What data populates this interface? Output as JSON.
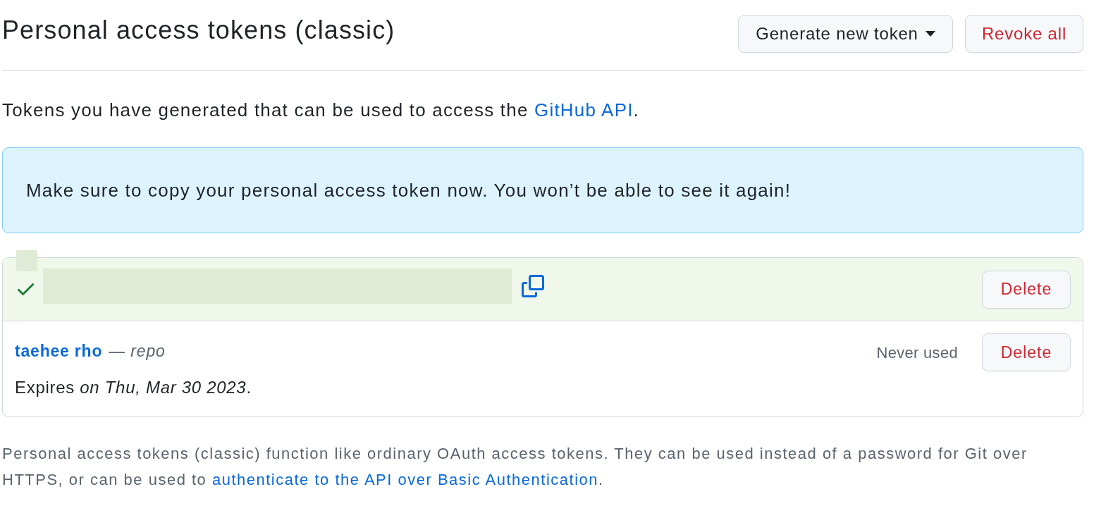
{
  "header": {
    "title": "Personal access tokens (classic)",
    "buttons": [
      {
        "kind": "dropdown",
        "label": "Generate new token"
      },
      {
        "kind": "danger",
        "label": "Revoke all"
      }
    ]
  },
  "intro": {
    "text": "Tokens you have generated that can be used to access the ",
    "link": "GitHub API",
    "after": "."
  },
  "flash": {
    "text": "Make sure to copy your personal access token now. You won’t be able to see it again!"
  },
  "tokens": [
    {
      "kind": "new",
      "delete_label": "Delete"
    },
    {
      "kind": "listed",
      "name": "taehee rho",
      "scopes": "— *repo*",
      "last_used": "Never used",
      "expires": "Expires *on Thu, Mar 30 2023*.",
      "delete_label": "Delete"
    }
  ],
  "footer": {
    "text": "Personal access tokens (classic) function like ordinary OAuth access tokens. They can be used instead of a password for Git over HTTPS, or can be used to ",
    "link": "authenticate to the API over Basic Authentication",
    "after": "."
  }
}
